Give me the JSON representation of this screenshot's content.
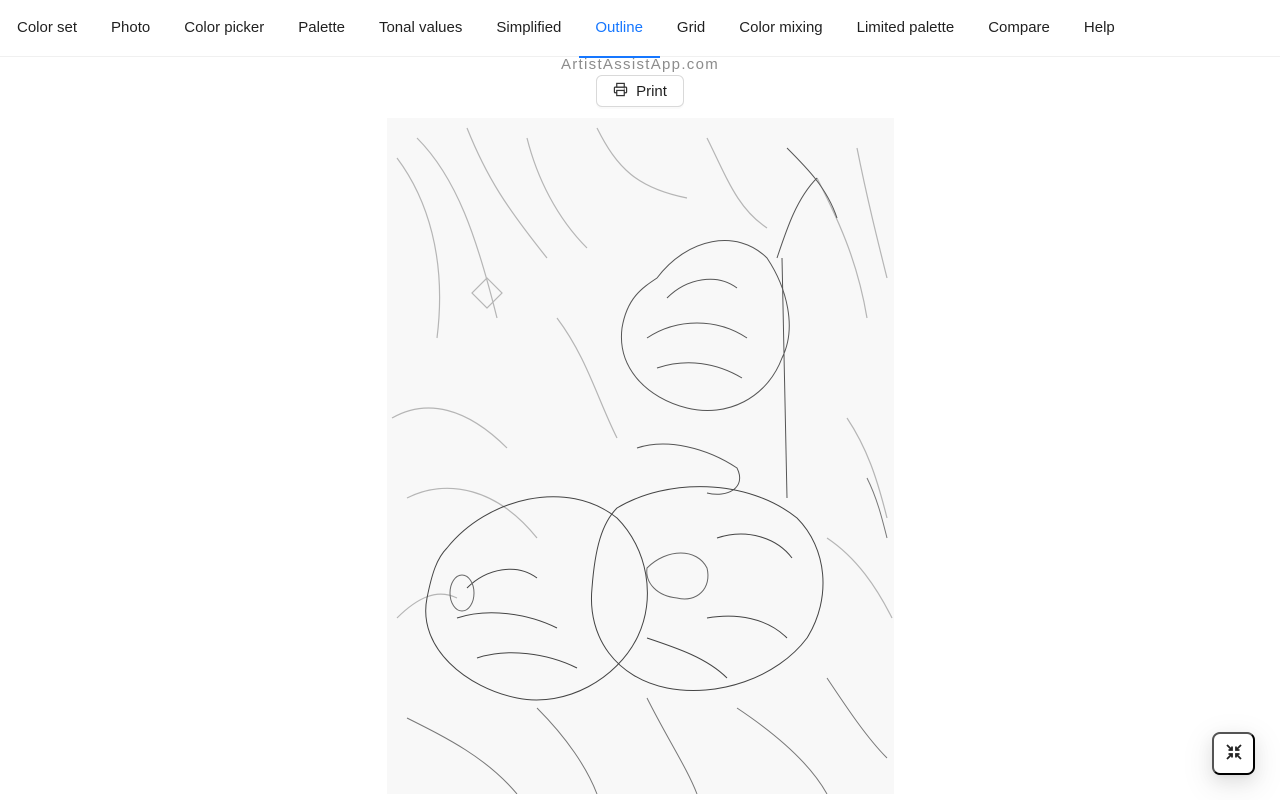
{
  "tabs": [
    {
      "label": "Color set",
      "active": false
    },
    {
      "label": "Photo",
      "active": false
    },
    {
      "label": "Color picker",
      "active": false
    },
    {
      "label": "Palette",
      "active": false
    },
    {
      "label": "Tonal values",
      "active": false
    },
    {
      "label": "Simplified",
      "active": false
    },
    {
      "label": "Outline",
      "active": true
    },
    {
      "label": "Grid",
      "active": false
    },
    {
      "label": "Color mixing",
      "active": false
    },
    {
      "label": "Limited palette",
      "active": false
    },
    {
      "label": "Compare",
      "active": false
    },
    {
      "label": "Help",
      "active": false
    }
  ],
  "accent_color": "#1677ff",
  "watermark": "ArtistAssistApp.com",
  "print_button": {
    "label": "Print",
    "icon": "printer-icon"
  },
  "outline_image": {
    "alt": "Pencil outline sketch of dahlia flowers with leaves"
  },
  "fullscreen_button": {
    "icon": "fullscreen-exit-icon"
  }
}
